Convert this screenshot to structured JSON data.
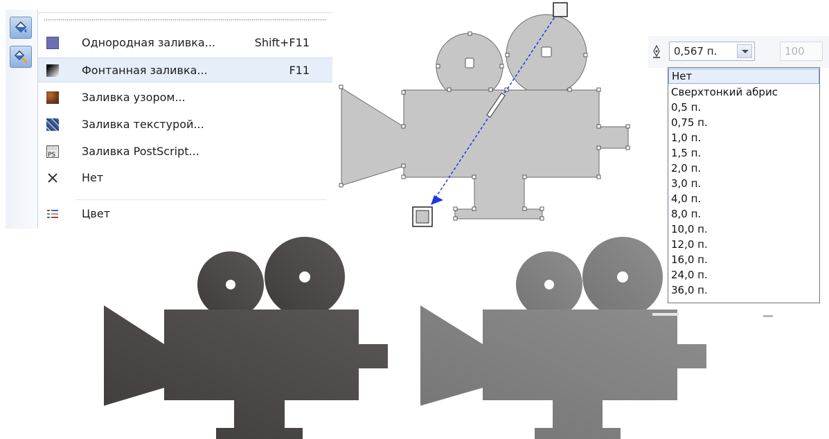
{
  "fill_menu": {
    "toolbar": [
      {
        "name": "fill-tool-icon"
      },
      {
        "name": "interactive-fill-icon"
      }
    ],
    "items": [
      {
        "label": "Однородная заливка...",
        "shortcut": "Shift+F11",
        "icon": "uniform-fill-icon",
        "highlighted": false
      },
      {
        "label": "Фонтанная заливка...",
        "shortcut": "F11",
        "icon": "fountain-fill-icon",
        "highlighted": true
      },
      {
        "label": "Заливка узором...",
        "shortcut": "",
        "icon": "pattern-fill-icon",
        "highlighted": false
      },
      {
        "label": "Заливка текстурой...",
        "shortcut": "",
        "icon": "texture-fill-icon",
        "highlighted": false
      },
      {
        "label": "Заливка PostScript...",
        "shortcut": "",
        "icon": "postscript-fill-icon",
        "highlighted": false
      },
      {
        "label": "Нет",
        "shortcut": "",
        "icon": "no-fill-icon",
        "highlighted": false
      },
      {
        "label": "Цвет",
        "shortcut": "",
        "icon": "color-docker-icon",
        "highlighted": false
      }
    ],
    "postscript_icon_text": "PS"
  },
  "outline_toolbar": {
    "width_value": "0,567 п.",
    "dim_value": "100",
    "options": [
      "Нет",
      "Сверхтонкий абрис",
      "0,5 п.",
      "0,75 п.",
      "1,0 п.",
      "1,5 п.",
      "2,0 п.",
      "3,0 п.",
      "4,0 п.",
      "8,0 п.",
      "10,0 п.",
      "12,0 п.",
      "16,0 п.",
      "24,0 п.",
      "36,0 п."
    ],
    "selected_index": 0
  },
  "colors": {
    "menu_highlight": "#e5eef9",
    "shape_gray": "#c6c6c6",
    "fill_vector": "#1a36e8",
    "dark_gradient_start": "#3e3b3a",
    "dark_gradient_end": "#5a5756",
    "light_gradient_start": "#747474",
    "light_gradient_end": "#8e8e8e"
  }
}
